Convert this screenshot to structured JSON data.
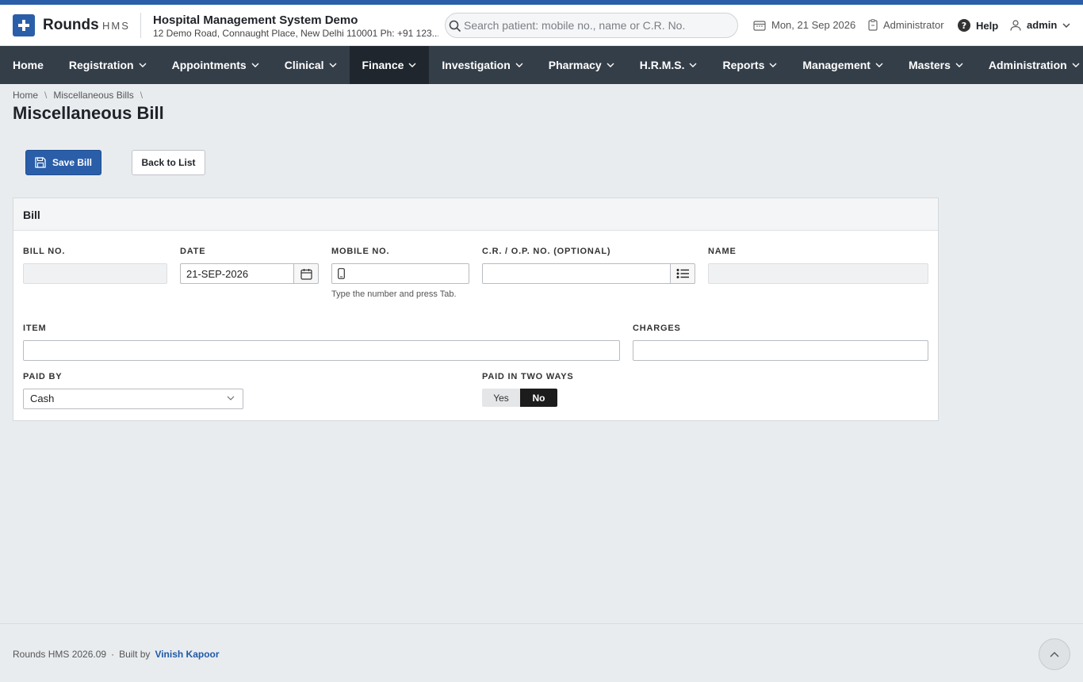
{
  "app": {
    "name": "Rounds",
    "sub": "HMS"
  },
  "hospital": {
    "name": "Hospital Management System Demo",
    "address": "12 Demo Road, Connaught Place, New Delhi 110001 Ph: +91 123..."
  },
  "search": {
    "placeholder": "Search patient: mobile no., name or C.R. No."
  },
  "header": {
    "date": "Mon, 21 Sep 2026",
    "role": "Administrator",
    "help": "Help",
    "user": "admin"
  },
  "nav": [
    "Home",
    "Registration",
    "Appointments",
    "Clinical",
    "Finance",
    "Investigation",
    "Pharmacy",
    "H.R.M.S.",
    "Reports",
    "Management",
    "Masters",
    "Administration"
  ],
  "breadcrumb": {
    "home": "Home",
    "current": "Miscellaneous Bills"
  },
  "page": {
    "title": "Miscellaneous Bill"
  },
  "buttons": {
    "save": "Save Bill",
    "back": "Back to List"
  },
  "panel": {
    "title": "Bill",
    "bill_no": {
      "label": "BILL NO.",
      "value": ""
    },
    "date": {
      "label": "DATE",
      "value": "21-SEP-2026"
    },
    "mobile": {
      "label": "MOBILE NO.",
      "value": "",
      "help": "Type the number and press Tab."
    },
    "cr": {
      "label": "C.R. / O.P. NO. (OPTIONAL)",
      "value": ""
    },
    "name": {
      "label": "NAME",
      "value": ""
    },
    "item": {
      "label": "ITEM",
      "value": ""
    },
    "charges": {
      "label": "CHARGES",
      "value": ""
    },
    "paid_by": {
      "label": "PAID BY",
      "value": "Cash"
    },
    "two_ways": {
      "label": "PAID IN TWO WAYS",
      "yes": "Yes",
      "no": "No",
      "selected": "No"
    }
  },
  "footer": {
    "version": "Rounds HMS 2026.09",
    "dot": "·",
    "built": "Built by",
    "author": "Vinish Kapoor"
  },
  "colors": {
    "primary": "#2a5ea8",
    "navbar": "#343e48",
    "nav_active": "#1f262d"
  }
}
